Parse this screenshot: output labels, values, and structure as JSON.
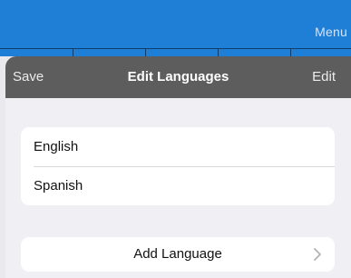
{
  "topbar": {
    "menu_label": "Menu"
  },
  "nav": {
    "save_label": "Save",
    "title": "Edit Languages",
    "edit_label": "Edit"
  },
  "languages": [
    {
      "label": "English"
    },
    {
      "label": "Spanish"
    }
  ],
  "add_language": {
    "label": "Add Language",
    "icon": "chevron-right-icon"
  },
  "colors": {
    "topbar": "#1f7fd6",
    "nav": "#5d5d5d",
    "background": "#efeff4",
    "card": "#ffffff"
  }
}
